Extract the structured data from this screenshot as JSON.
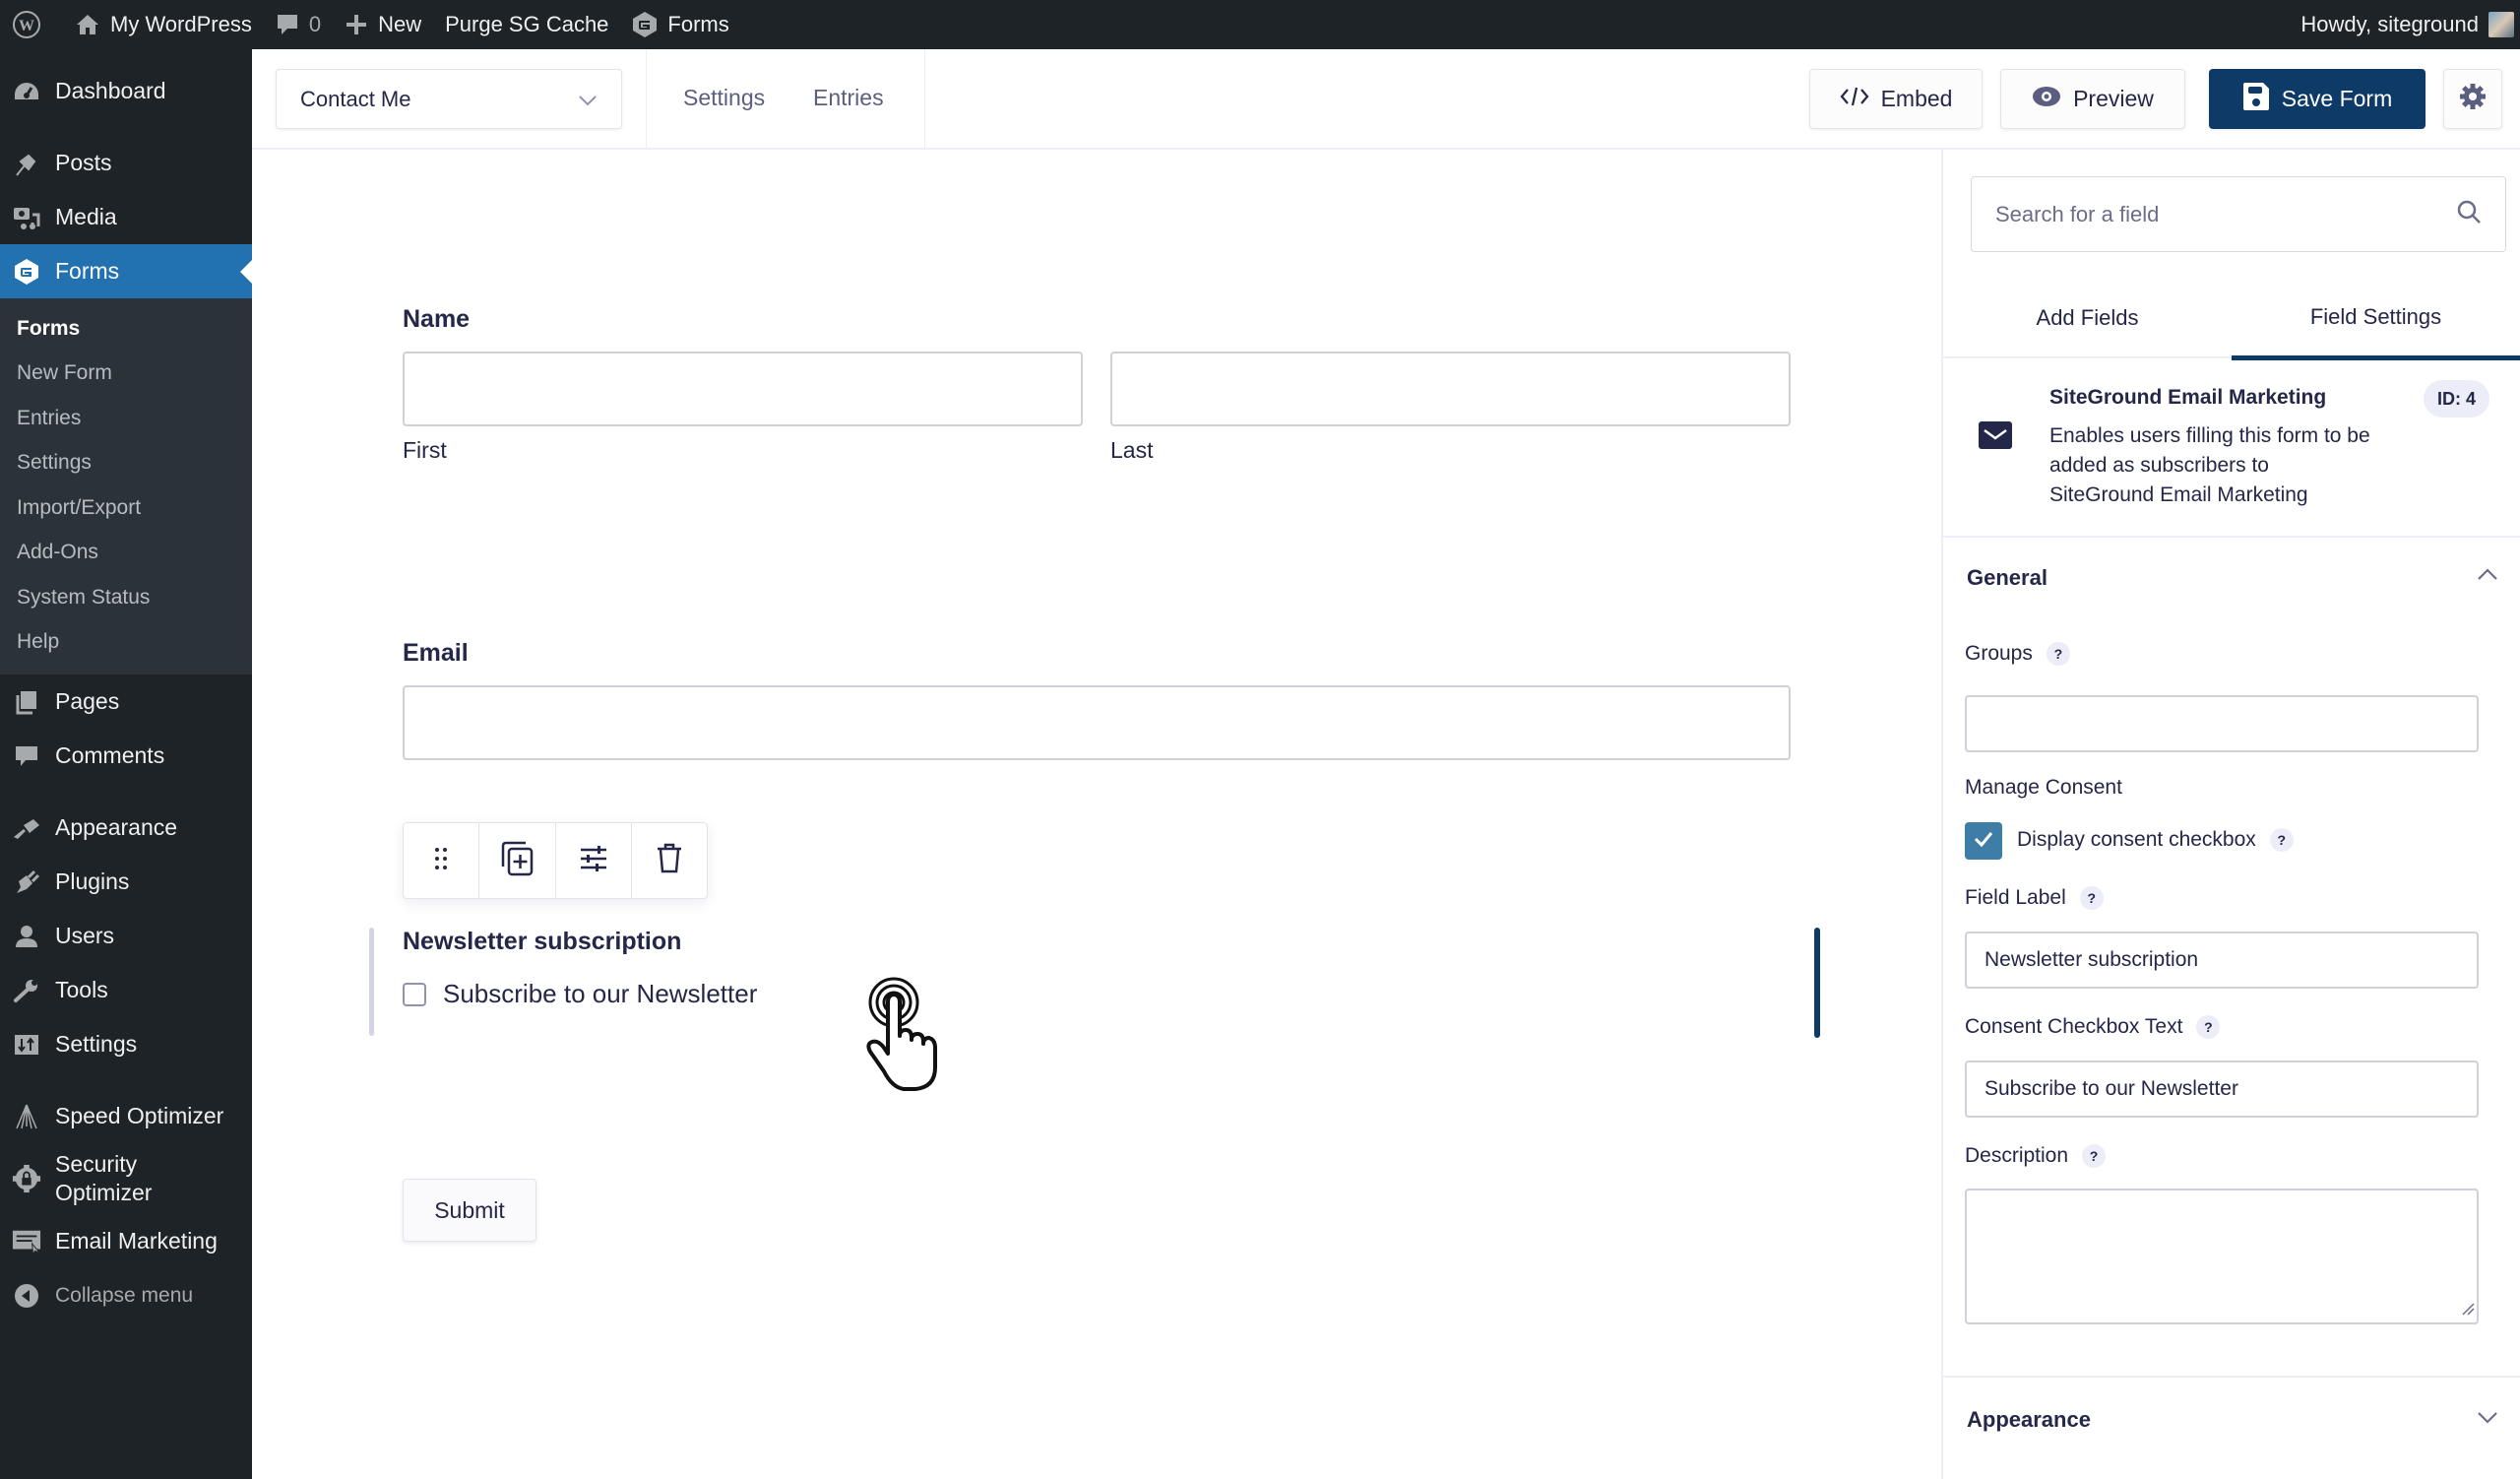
{
  "adminbar": {
    "site_name": "My WordPress",
    "comments_count": "0",
    "new_label": "New",
    "purge_label": "Purge SG Cache",
    "forms_label": "Forms",
    "greeting": "Howdy, siteground"
  },
  "sidebar": {
    "items": [
      {
        "label": "Dashboard",
        "icon": "dashboard-icon"
      },
      {
        "label": "Posts",
        "icon": "pin-icon"
      },
      {
        "label": "Media",
        "icon": "media-icon"
      },
      {
        "label": "Forms",
        "icon": "gravity-forms-icon",
        "active": true
      },
      {
        "label": "Pages",
        "icon": "pages-icon"
      },
      {
        "label": "Comments",
        "icon": "comment-icon"
      },
      {
        "label": "Appearance",
        "icon": "brush-icon"
      },
      {
        "label": "Plugins",
        "icon": "plugin-icon"
      },
      {
        "label": "Users",
        "icon": "user-icon"
      },
      {
        "label": "Tools",
        "icon": "wrench-icon"
      },
      {
        "label": "Settings",
        "icon": "settings-icon"
      },
      {
        "label": "Speed Optimizer",
        "icon": "speed-icon"
      },
      {
        "label": "Security Optimizer",
        "icon": "security-gear-icon"
      },
      {
        "label": "Email Marketing",
        "icon": "email-marketing-icon"
      }
    ],
    "submenu": [
      "Forms",
      "New Form",
      "Entries",
      "Settings",
      "Import/Export",
      "Add-Ons",
      "System Status",
      "Help"
    ],
    "collapse_label": "Collapse menu"
  },
  "toolbar": {
    "form_name": "Contact Me",
    "settings_link": "Settings",
    "entries_link": "Entries",
    "embed_label": "Embed",
    "preview_label": "Preview",
    "save_label": "Save Form"
  },
  "form": {
    "name_label": "Name",
    "first_label": "First",
    "last_label": "Last",
    "email_label": "Email",
    "newsletter_label": "Newsletter subscription",
    "newsletter_checkbox_text": "Subscribe to our Newsletter",
    "newsletter_checked": false,
    "submit_label": "Submit"
  },
  "panel": {
    "search_placeholder": "Search for a field",
    "tabs": [
      "Add Fields",
      "Field Settings"
    ],
    "active_tab": "Field Settings",
    "field_title": "SiteGround Email Marketing",
    "field_description": "Enables users filling this form to be added as subscribers to SiteGround Email Marketing",
    "field_id": "ID: 4",
    "general_title": "General",
    "groups_label": "Groups",
    "groups_value": "",
    "manage_consent_label": "Manage Consent",
    "display_consent_label": "Display consent checkbox",
    "display_consent_checked": true,
    "field_label_label": "Field Label",
    "field_label_value": "Newsletter subscription",
    "consent_text_label": "Consent Checkbox Text",
    "consent_text_value": "Subscribe to our Newsletter",
    "description_label": "Description",
    "description_value": "",
    "appearance_title": "Appearance",
    "help_glyph": "?"
  },
  "colors": {
    "wp_dark": "#1d2327",
    "wp_blue": "#2271b1",
    "primary": "#0e3a68",
    "checkbox_blue": "#3e7da6"
  }
}
